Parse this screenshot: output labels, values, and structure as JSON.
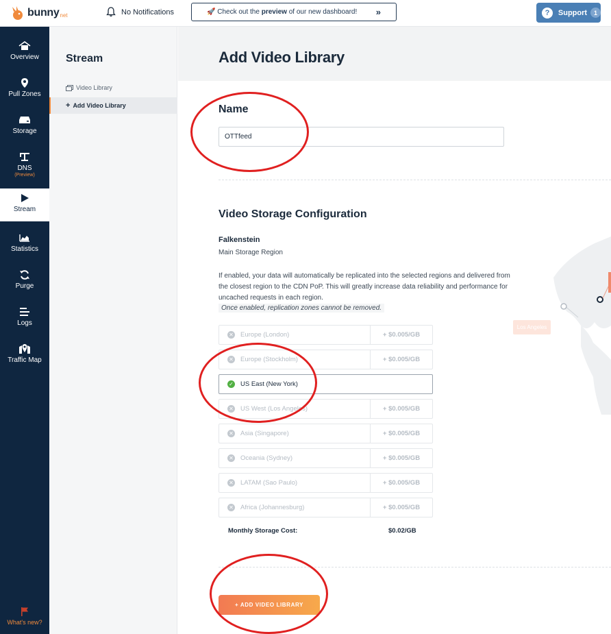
{
  "topbar": {
    "brand": "bunny",
    "brand_tld": "net",
    "notifications": "No Notifications",
    "preview_prefix": "🚀 Check out the ",
    "preview_bold": "preview",
    "preview_suffix": " of our new dashboard!",
    "preview_arrow": "»",
    "support_label": "Support",
    "support_count": "1"
  },
  "leftnav": {
    "items": [
      {
        "label": "Overview",
        "icon": "home-icon"
      },
      {
        "label": "Pull Zones",
        "icon": "location-pin-icon"
      },
      {
        "label": "Storage",
        "icon": "storage-drive-icon"
      },
      {
        "label": "DNS",
        "icon": "dns-icon",
        "sub": "(Preview)"
      },
      {
        "label": "Stream",
        "icon": "play-icon"
      },
      {
        "label": "Statistics",
        "icon": "chart-icon"
      },
      {
        "label": "Purge",
        "icon": "refresh-icon"
      },
      {
        "label": "Logs",
        "icon": "list-icon"
      },
      {
        "label": "Traffic Map",
        "icon": "map-pin-icon"
      }
    ],
    "whats_new": "What's new?"
  },
  "subnav": {
    "title": "Stream",
    "items": [
      {
        "label": "Video Library"
      },
      {
        "label": "Add Video Library"
      }
    ]
  },
  "main": {
    "page_title": "Add Video Library",
    "name_label": "Name",
    "name_value": "OTTfeed",
    "storage_title": "Video Storage Configuration",
    "region_name": "Falkenstein",
    "region_sub": "Main Storage Region",
    "description": "If enabled, your data will automatically be replicated into the selected regions and delivered from the closest region to the CDN PoP. This will greatly increase data reliability and performance for uncached requests in each region.",
    "warning": "Once enabled, replication zones cannot be removed.",
    "regions": [
      {
        "label": "Europe (London)",
        "price": "+ $0.005/GB",
        "enabled": false
      },
      {
        "label": "Europe (Stockholm)",
        "price": "+ $0.005/GB",
        "enabled": false
      },
      {
        "label": "US East (New York)",
        "price": "",
        "enabled": true
      },
      {
        "label": "US West (Los Angeles)",
        "price": "+ $0.005/GB",
        "enabled": false
      },
      {
        "label": "Asia (Singapore)",
        "price": "+ $0.005/GB",
        "enabled": false
      },
      {
        "label": "Oceania (Sydney)",
        "price": "+ $0.005/GB",
        "enabled": false
      },
      {
        "label": "LATAM (Sao Paulo)",
        "price": "+ $0.005/GB",
        "enabled": false
      },
      {
        "label": "Africa (Johannesburg)",
        "price": "+ $0.005/GB",
        "enabled": false
      }
    ],
    "cost_label": "Monthly Storage Cost:",
    "cost_value": "$0.02/GB",
    "add_button": "+ ADD VIDEO LIBRARY",
    "map_label": "Los Angeles"
  },
  "colors": {
    "nav_bg": "#0f2640",
    "accent": "#f08a3c",
    "support_bg": "#4a7fb5",
    "enabled_check": "#52b043",
    "annotation": "#e02020"
  }
}
